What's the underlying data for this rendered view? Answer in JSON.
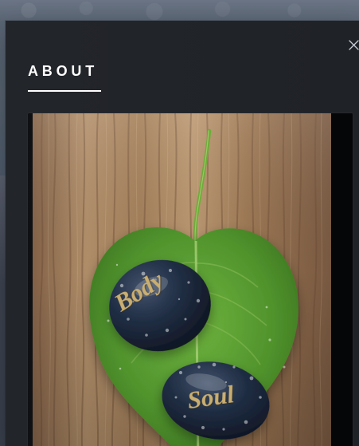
{
  "modal": {
    "title": "ABOUT",
    "close_icon": "close-icon"
  },
  "image": {
    "stone_top_text": "Body",
    "stone_bottom_text": "Soul"
  },
  "colors": {
    "background": "#4f5a69",
    "modal": "#1f2227",
    "title": "#ffffff",
    "close": "#c9ced6",
    "wood_light": "#b5916b",
    "wood_dark": "#5d4330",
    "leaf": "#4f8f2c",
    "stone": "#1c2636",
    "stone_text": "#c9ad70"
  }
}
